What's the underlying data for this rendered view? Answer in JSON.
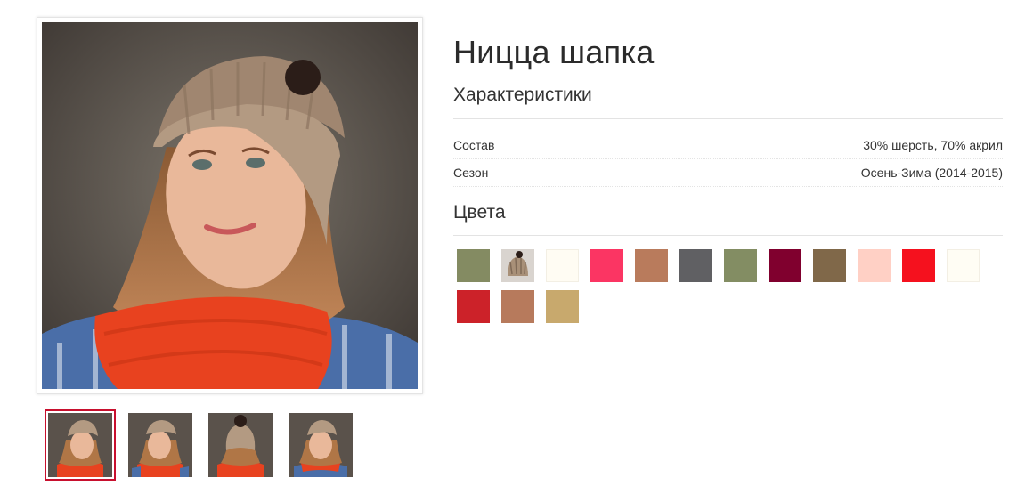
{
  "product": {
    "title": "Ницца шапка"
  },
  "characteristics": {
    "heading": "Характеристики",
    "rows": [
      {
        "label": "Состав",
        "value": "30% шерсть, 70% акрил"
      },
      {
        "label": "Сезон",
        "value": "Осень-Зима (2014-2015)"
      }
    ]
  },
  "colors": {
    "heading": "Цвета",
    "swatches": [
      "#848b62",
      "photo",
      "#fffcf3",
      "#fb3563",
      "#b97b5c",
      "#606063",
      "#838d63",
      "#80002e",
      "#806849",
      "#ffd0c5",
      "#f5111e",
      "#fffdf4",
      "#cc2229",
      "#b77a5c",
      "#c8a96d"
    ]
  },
  "gallery": {
    "active_index": 0,
    "thumb_count": 4
  }
}
